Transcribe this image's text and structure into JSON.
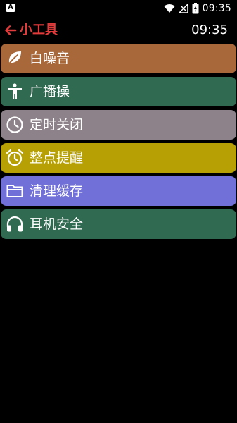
{
  "status_bar": {
    "time": "09:35"
  },
  "app_bar": {
    "title": "小工具",
    "clock": "09:35"
  },
  "menu": {
    "items": [
      {
        "label": "白噪音",
        "color": "#a8683a",
        "icon": "leaf-icon"
      },
      {
        "label": "广播操",
        "color": "#2f6a51",
        "icon": "person-icon"
      },
      {
        "label": "定时关闭",
        "color": "#8d828a",
        "icon": "clock-icon"
      },
      {
        "label": "整点提醒",
        "color": "#b6a004",
        "icon": "alarm-icon"
      },
      {
        "label": "清理缓存",
        "color": "#7070d8",
        "icon": "folder-icon"
      },
      {
        "label": "耳机安全",
        "color": "#2f6a51",
        "icon": "headphones-icon"
      }
    ]
  }
}
